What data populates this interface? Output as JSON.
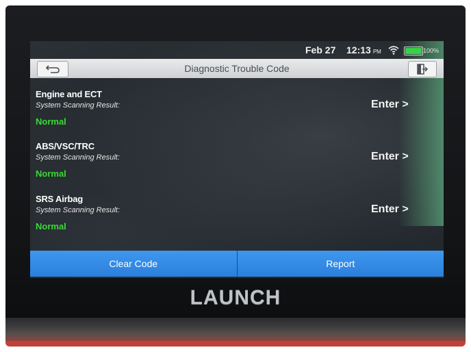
{
  "status_bar": {
    "date": "Feb 27",
    "time": "12:13",
    "ampm": "PM",
    "battery_percent": "100%"
  },
  "header": {
    "title": "Diagnostic Trouble Code",
    "back_icon": "back-arrow-icon",
    "exit_icon": "exit-icon"
  },
  "systems": [
    {
      "name": "Engine and ECT",
      "result_label": "System Scanning Result:",
      "status": "Normal",
      "action_label": "Enter >"
    },
    {
      "name": "ABS/VSC/TRC",
      "result_label": "System Scanning Result:",
      "status": "Normal",
      "action_label": "Enter >"
    },
    {
      "name": "SRS Airbag",
      "result_label": "System Scanning Result:",
      "status": "Normal",
      "action_label": "Enter >"
    }
  ],
  "buttons": {
    "clear_code": "Clear Code",
    "report": "Report"
  },
  "device": {
    "brand": "LAUNCH"
  },
  "colors": {
    "accent_blue": "#2a85e2",
    "status_green": "#3ad936",
    "battery_green": "#39d14a",
    "case_red": "#c0413a"
  }
}
